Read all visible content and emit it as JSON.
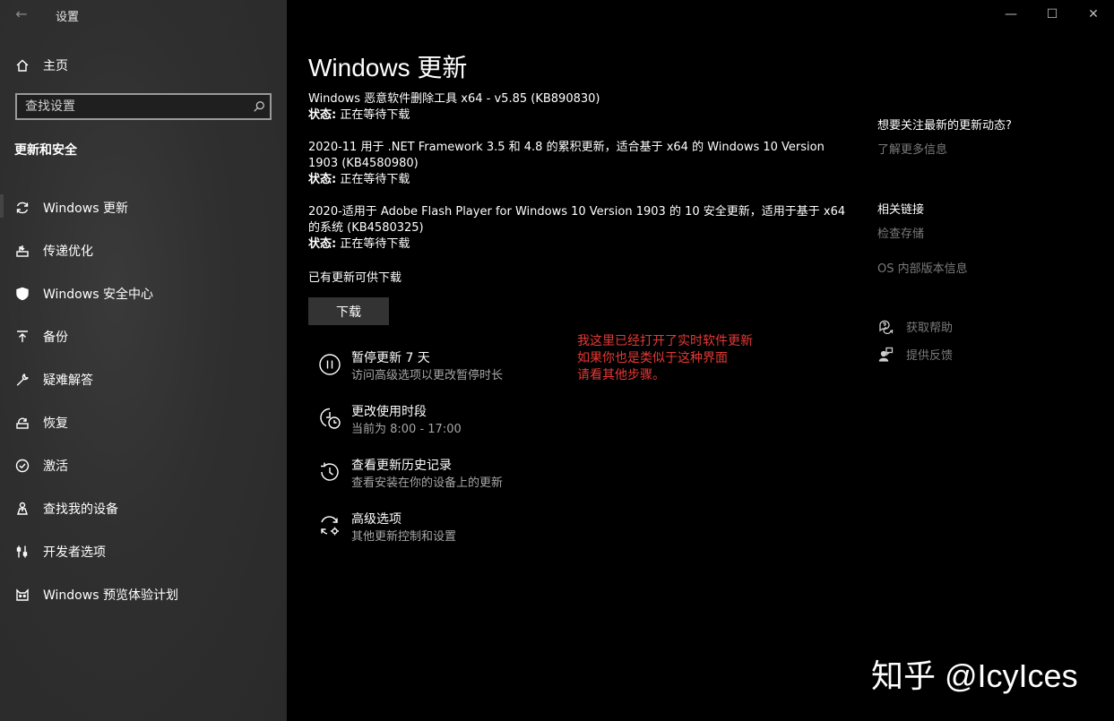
{
  "window": {
    "title": "设置",
    "back": "←",
    "minimize": "—",
    "maximize": "☐",
    "close": "✕"
  },
  "sidebar": {
    "home": "主页",
    "search_placeholder": "查找设置",
    "section": "更新和安全",
    "items": [
      {
        "label": "Windows 更新",
        "icon": "refresh-icon"
      },
      {
        "label": "传递优化",
        "icon": "delivery-icon"
      },
      {
        "label": "Windows 安全中心",
        "icon": "shield-icon"
      },
      {
        "label": "备份",
        "icon": "backup-icon"
      },
      {
        "label": "疑难解答",
        "icon": "wrench-icon"
      },
      {
        "label": "恢复",
        "icon": "recovery-icon"
      },
      {
        "label": "激活",
        "icon": "check-circle-icon"
      },
      {
        "label": "查找我的设备",
        "icon": "person-location-icon"
      },
      {
        "label": "开发者选项",
        "icon": "developer-icon"
      },
      {
        "label": "Windows 预览体验计划",
        "icon": "insider-cat-icon"
      }
    ]
  },
  "main": {
    "title": "Windows 更新",
    "updates": [
      {
        "name": "Windows 恶意软件删除工具 x64 - v5.85 (KB890830)",
        "status_label": "状态:",
        "status": " 正在等待下载"
      },
      {
        "name": "2020-11 用于 .NET Framework 3.5 和 4.8 的累积更新，适合基于 x64 的 Windows 10 Version 1903 (KB4580980)",
        "status_label": "状态:",
        "status": " 正在等待下载"
      },
      {
        "name": "2020-适用于 Adobe Flash Player for Windows 10 Version 1903 的 10 安全更新，适用于基于 x64 的系统 (KB4580325)",
        "status_label": "状态:",
        "status": " 正在等待下载"
      }
    ],
    "available": "已有更新可供下载",
    "download_button": "下载",
    "options": [
      {
        "title": "暂停更新 7 天",
        "subtitle": "访问高级选项以更改暂停时长",
        "icon": "pause-icon"
      },
      {
        "title": "更改使用时段",
        "subtitle": "当前为 8:00 - 17:00",
        "icon": "active-hours-icon"
      },
      {
        "title": "查看更新历史记录",
        "subtitle": "查看安装在你的设备上的更新",
        "icon": "history-icon"
      },
      {
        "title": "高级选项",
        "subtitle": "其他更新控制和设置",
        "icon": "advanced-settings-icon"
      }
    ],
    "annotation": [
      "我这里已经打开了实时软件更新",
      "如果你也是类似于这种界面",
      "请看其他步骤。"
    ],
    "annotation_color": "#e53935"
  },
  "right": {
    "news_heading": "想要关注最新的更新动态?",
    "learn_more": "了解更多信息",
    "links_heading": "相关链接",
    "check_storage": "检查存储",
    "os_build": "OS 内部版本信息",
    "get_help": "获取帮助",
    "feedback": "提供反馈"
  },
  "watermark": "知乎 @IcyIces"
}
